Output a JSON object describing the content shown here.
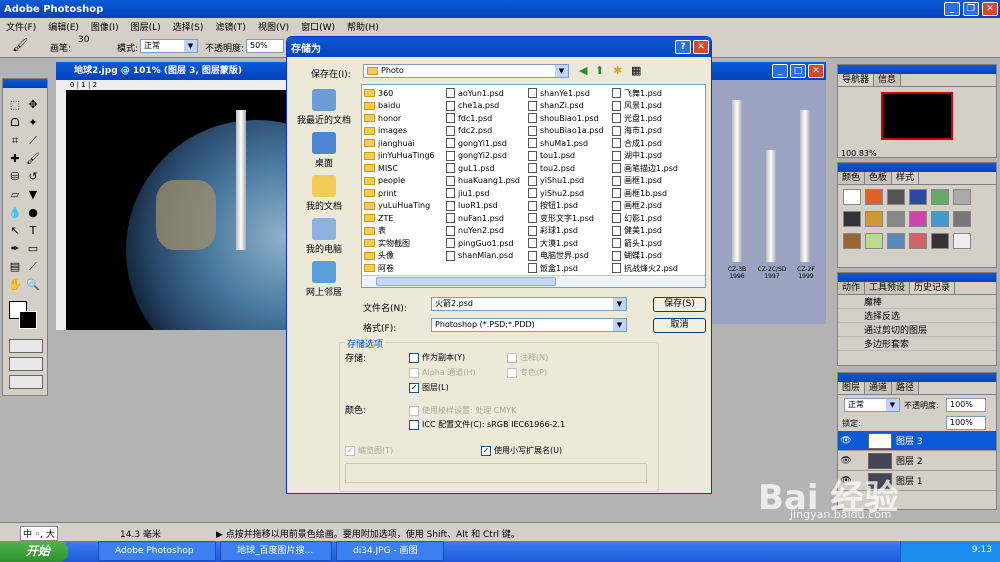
{
  "app": {
    "title": "Adobe Photoshop"
  },
  "menubar": [
    "文件(F)",
    "编辑(E)",
    "图像(I)",
    "图层(L)",
    "选择(S)",
    "滤镜(T)",
    "视图(V)",
    "窗口(W)",
    "帮助(H)"
  ],
  "options": {
    "brush_label": "画笔:",
    "brush_size": "30",
    "mode_label": "模式:",
    "mode_value": "正常",
    "opacity_label": "不透明度:",
    "opacity_value": "50%"
  },
  "document": {
    "title": "地球2.jpg @ 101% (图层 3, 图层蒙版)",
    "ruler": "0 | 1 | 2"
  },
  "rocket_labels": [
    "CZ-3B\n1996",
    "CZ-2C/SD\n1997",
    "CZ-2F\n1999"
  ],
  "dialog": {
    "title": "存储为",
    "save_in_label": "保存在(I):",
    "save_in_value": "Photo",
    "places": [
      "我最近的文档",
      "桌面",
      "我的文档",
      "我的电脑",
      "网上邻居"
    ],
    "files_col1": [
      "360",
      "baidu",
      "honor",
      "images",
      "jianghuai",
      "jinYuHuaTing6",
      "MISC",
      "people",
      "print",
      "yuLuHuaTing",
      "ZTE",
      "表",
      "实物截图",
      "头像",
      "阿卷"
    ],
    "files_col2": [
      "aoYun1.psd",
      "che1a.psd",
      "fdc1.psd",
      "fdc2.psd",
      "gongYi1.psd",
      "gongYi2.psd",
      "guL1.psd",
      "huaKuang1.psd",
      "jiu1.psd",
      "luoR1.psd",
      "nuFan1.psd",
      "nuYen2.psd",
      "pingGuo1.psd",
      "shanMian.psd"
    ],
    "files_col3": [
      "shanYe1.psd",
      "shanZi.psd",
      "shouBiao1.psd",
      "shouBiao1a.psd",
      "shuMa1.psd",
      "tou1.psd",
      "tou2.psd",
      "yiShu1.psd",
      "yiShu2.psd",
      "按钮1.psd",
      "变形文字1.psd",
      "彩球1.psd",
      "大漠1.psd",
      "电脑世界.psd",
      "饭盒1.psd"
    ],
    "files_col4": [
      "飞舞1.psd",
      "风景1.psd",
      "光盘1.psd",
      "海市1.psd",
      "合成1.psd",
      "湖中1.psd",
      "画笔描边1.psd",
      "画框1.psd",
      "画框1b.psd",
      "画框2.psd",
      "幻影1.psd",
      "健美1.psd",
      "箭头1.psd",
      "蝴蝶1.psd",
      "抗战烽火2.psd"
    ],
    "filename_label": "文件名(N):",
    "filename_value": "火箭2.psd",
    "format_label": "格式(F):",
    "format_value": "Photoshop (*.PSD;*.PDD)",
    "save_button": "保存(S)",
    "cancel_button": "取消",
    "options_group": "存储选项",
    "store_label": "存储:",
    "as_copy": "作为副本(Y)",
    "annotations": "注释(N)",
    "alpha": "Alpha 通道(H)",
    "spot": "专色(P)",
    "layers": "图层(L)",
    "color_label": "颜色:",
    "proof": "使用校样设置: 处理 CMYK",
    "icc": "ICC 配置文件(C): sRGB IEC61966-2.1",
    "thumbnail": "缩览图(T)",
    "lowercase_ext": "使用小写扩展名(U)"
  },
  "navigator": {
    "tabs": [
      "导航器",
      "信息"
    ],
    "zoom": "100.83%"
  },
  "swatches": {
    "tabs": [
      "颜色",
      "色板",
      "样式"
    ]
  },
  "history": {
    "tabs": [
      "动作",
      "工具预设",
      "历史记录"
    ],
    "items": [
      "魔棒",
      "选择反选",
      "通过剪切的图层",
      "多边形套索"
    ]
  },
  "layers": {
    "tabs": [
      "图层",
      "通道",
      "路径"
    ],
    "blend": "正常",
    "opacity_label": "不透明度:",
    "opacity": "100%",
    "lock_label": "锁定:",
    "fill": "100%",
    "items": [
      "图层 3",
      "图层 2",
      "图层 1"
    ]
  },
  "status": {
    "size": "14.3 毫米",
    "hint": "▶ 点按并拖移以用前景色绘画。要用附加选项，使用 Shift、Alt 和 Ctrl 键。",
    "ime": "中 ◦, 大"
  },
  "taskbar": {
    "start": "开始",
    "tasks": [
      "Adobe Photoshop",
      "地球_百度图片搜...",
      "di34.JPG - 画图"
    ],
    "clock": "9:13"
  },
  "watermark": {
    "text": "Bai 经验",
    "url": "jingyan.baidu.com"
  },
  "colors": {
    "xp_blue": "#0a5ad6",
    "panel_gray": "#d4d0c8",
    "taskbar": "#245edb",
    "start_green": "#3c9f3c"
  }
}
